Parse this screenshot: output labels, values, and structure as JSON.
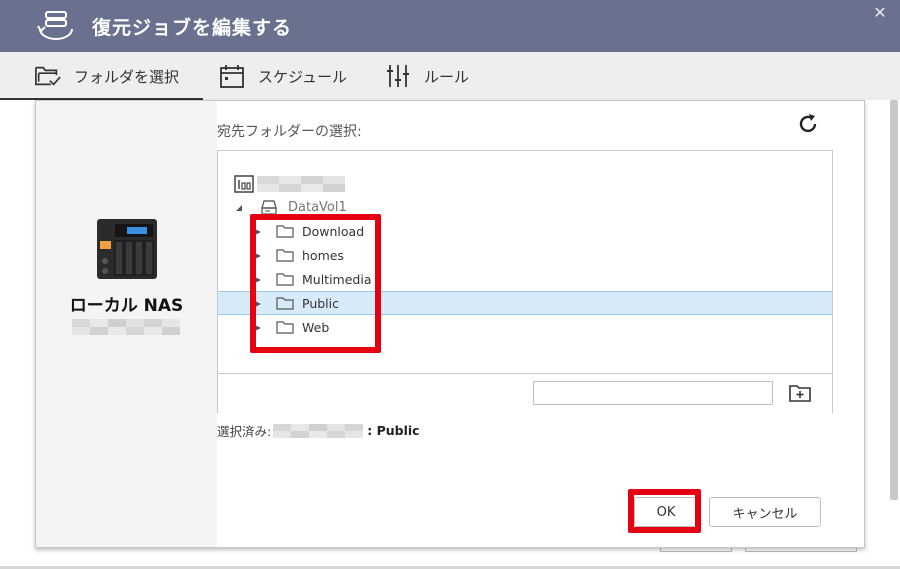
{
  "titlebar": {
    "title": "復元ジョブを編集する",
    "app_icon": "backup-job-icon",
    "close_glyph": "✕"
  },
  "tabs": [
    {
      "label": "フォルダを選択",
      "icon": "folder-check-icon",
      "active": true
    },
    {
      "label": "スケジュール",
      "icon": "calendar-icon",
      "active": false
    },
    {
      "label": "ルール",
      "icon": "sliders-icon",
      "active": false
    }
  ],
  "source": {
    "nas_name": "ローカル NAS",
    "nas_icon": "nas-device-icon"
  },
  "destination": {
    "label": "宛先フォルダーの選択:",
    "volume": "DataVol1",
    "folders": [
      {
        "name": "Download",
        "selected": false
      },
      {
        "name": "homes",
        "selected": false
      },
      {
        "name": "Multimedia",
        "selected": false
      },
      {
        "name": "Public",
        "selected": true
      },
      {
        "name": "Web",
        "selected": false
      }
    ],
    "new_folder_placeholder": ""
  },
  "selected": {
    "label": "選択済み:",
    "value": ": Public"
  },
  "buttons": {
    "ok": "OK",
    "cancel": "キャンセル"
  },
  "colors": {
    "titlebar": "#69718f",
    "selection": "#d6eaf8",
    "annotation": "#e50012"
  }
}
